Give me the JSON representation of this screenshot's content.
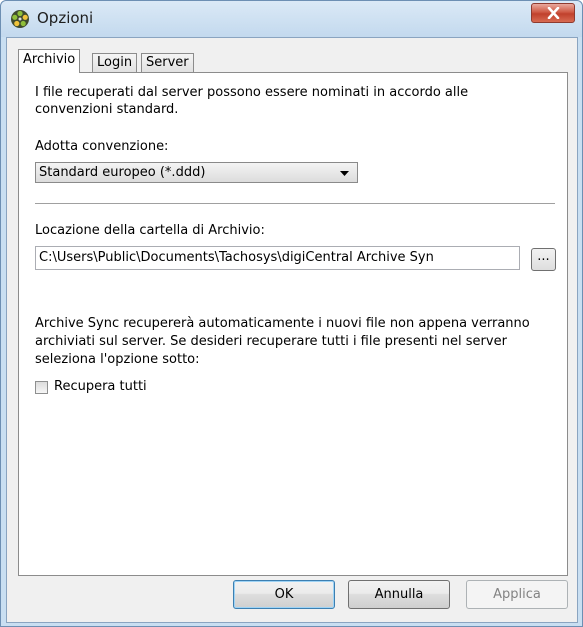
{
  "window": {
    "title": "Opzioni"
  },
  "icons": {
    "app": "reel-icon",
    "close": "close-icon"
  },
  "tabs": [
    {
      "label": "Archivio",
      "active": true
    },
    {
      "label": "Login",
      "active": false
    },
    {
      "label": "Server",
      "active": false
    }
  ],
  "archivio": {
    "intro": "I file recuperati dal server possono essere nominati in accordo alle convenzioni standard.",
    "convention_label": "Adotta convenzione:",
    "convention_value": "Standard europeo (*.ddd)",
    "location_label": "Locazione della cartella di Archivio:",
    "location_value": "C:\\Users\\Public\\Documents\\Tachosys\\digiCentral Archive Syn",
    "browse_label": "...",
    "sync_text": "Archive Sync recupererà automaticamente i nuovi file non appena verranno archiviati sul server. Se desideri recuperare tutti i file presenti nel server seleziona l'opzione sotto:",
    "retrieve_all_label": "Recupera tutti",
    "retrieve_all_checked": false
  },
  "buttons": {
    "ok": "OK",
    "cancel": "Annulla",
    "apply": "Applica"
  },
  "colors": {
    "titlebar": "#c9dff2",
    "close": "#c0412c",
    "dialog": "#f0f0f0"
  }
}
